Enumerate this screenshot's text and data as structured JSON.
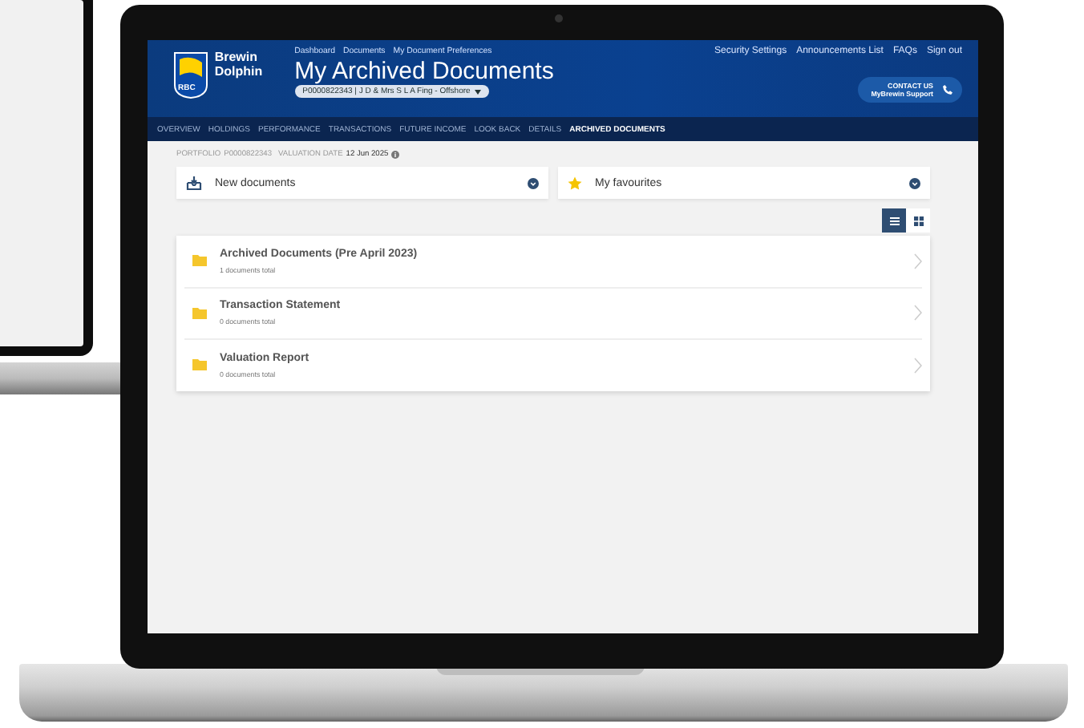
{
  "brand": {
    "logo_text": "RBC",
    "name_line1": "Brewin",
    "name_line2": "Dolphin"
  },
  "top_links": [
    "Dashboard",
    "Documents",
    "My Document Preferences"
  ],
  "page_title": "My Archived Documents",
  "account_selector": {
    "value": "P0000822343 | J D & Mrs S L A Fing - Offshore"
  },
  "utility_links": [
    "Security Settings",
    "Announcements List",
    "FAQs",
    "Sign out"
  ],
  "contact": {
    "line1": "CONTACT US",
    "line2": "MyBrewin Support"
  },
  "nav_tabs": [
    {
      "label": "OVERVIEW",
      "selected": false
    },
    {
      "label": "HOLDINGS",
      "selected": false
    },
    {
      "label": "PERFORMANCE",
      "selected": false
    },
    {
      "label": "TRANSACTIONS",
      "selected": false
    },
    {
      "label": "FUTURE INCOME",
      "selected": false
    },
    {
      "label": "LOOK BACK",
      "selected": false
    },
    {
      "label": "DETAILS",
      "selected": false
    },
    {
      "label": "ARCHIVED DOCUMENTS",
      "selected": true
    }
  ],
  "portfolio_info": {
    "portfolio_label": "PORTFOLIO",
    "portfolio_value": "P0000822343",
    "valuation_label": "VALUATION DATE",
    "valuation_value": "12 Jun 2025"
  },
  "panels": [
    {
      "kind": "inbox",
      "label": "New documents"
    },
    {
      "kind": "star",
      "label": "My favourites"
    }
  ],
  "view_toggle": [
    {
      "kind": "list",
      "selected": true
    },
    {
      "kind": "grid",
      "selected": false
    }
  ],
  "folders": [
    {
      "title": "Archived Documents (Pre April 2023)",
      "subtitle": "1 documents total"
    },
    {
      "title": "Transaction Statement",
      "subtitle": "0 documents total"
    },
    {
      "title": "Valuation Report",
      "subtitle": "0 documents total"
    }
  ]
}
